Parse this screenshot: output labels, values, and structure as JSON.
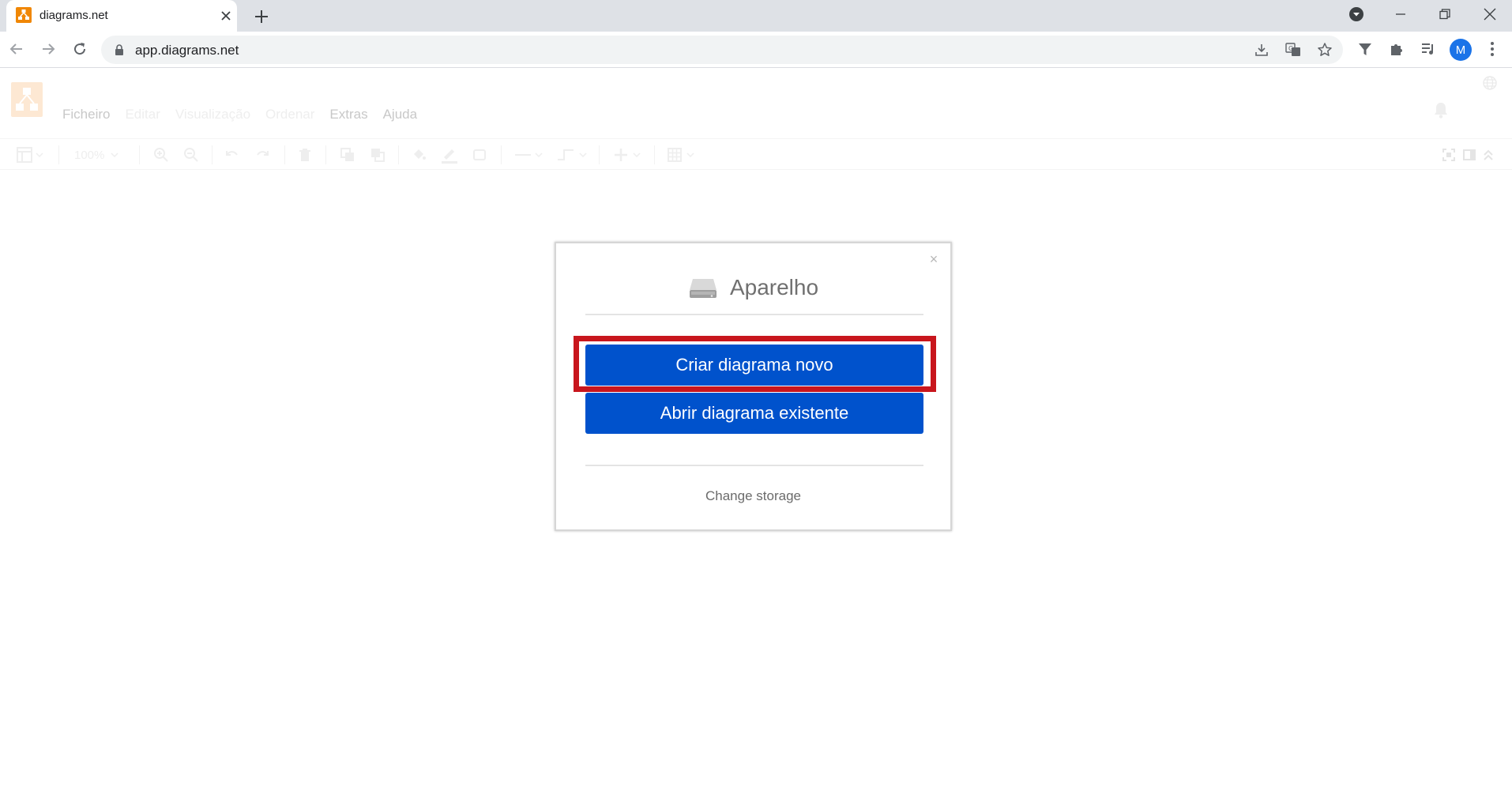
{
  "browser": {
    "tab": {
      "title": "diagrams.net",
      "favicon": "diagrams-net-icon"
    },
    "address": {
      "url": "app.diagrams.net"
    },
    "profile_initial": "M"
  },
  "app": {
    "menu": [
      {
        "label": "Ficheiro",
        "enabled": true
      },
      {
        "label": "Editar",
        "enabled": false
      },
      {
        "label": "Visualização",
        "enabled": false
      },
      {
        "label": "Ordenar",
        "enabled": false
      },
      {
        "label": "Extras",
        "enabled": true
      },
      {
        "label": "Ajuda",
        "enabled": true
      }
    ],
    "toolbar": {
      "zoom": "100%"
    },
    "brand_color": "#f08705"
  },
  "dialog": {
    "title": "Aparelho",
    "close_glyph": "×",
    "buttons": {
      "create": "Criar diagrama novo",
      "open": "Abrir diagrama existente"
    },
    "change_storage": "Change storage",
    "button_color": "#0052cc",
    "highlight_color": "#c8161d"
  }
}
